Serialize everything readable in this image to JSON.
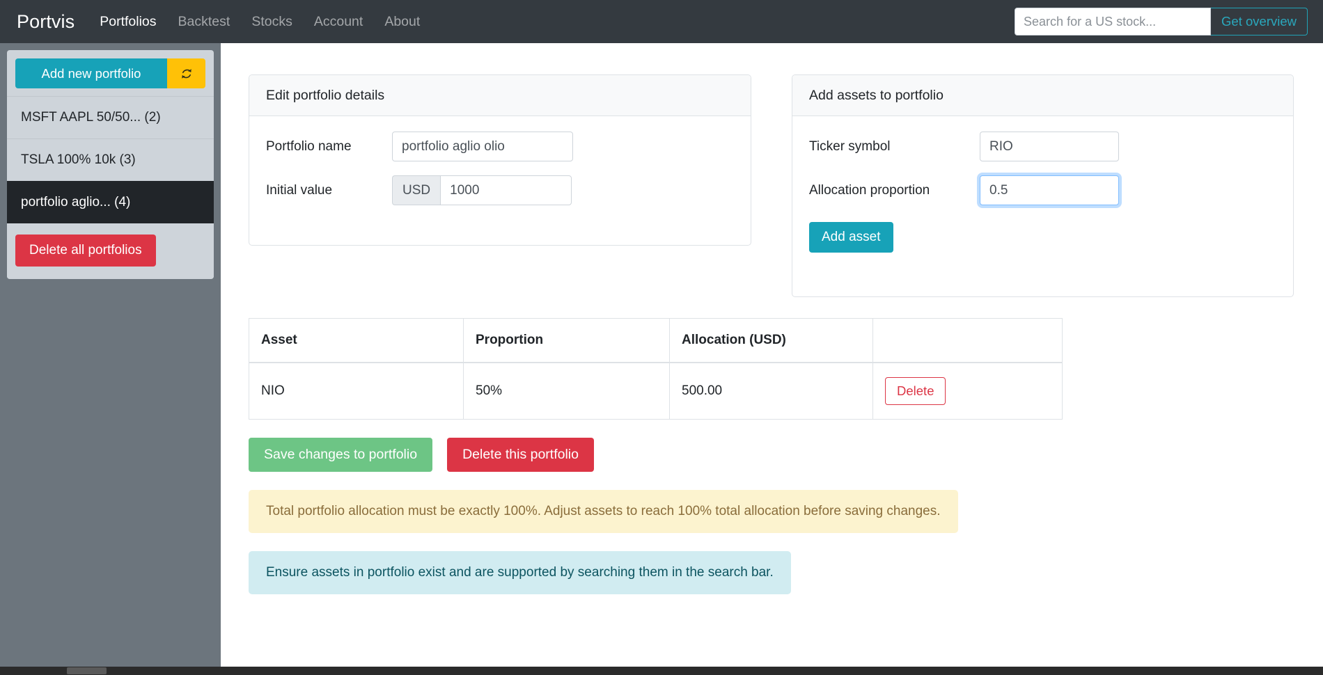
{
  "navbar": {
    "brand": "Portvis",
    "links": [
      {
        "label": "Portfolios",
        "active": true
      },
      {
        "label": "Backtest",
        "active": false
      },
      {
        "label": "Stocks",
        "active": false
      },
      {
        "label": "Account",
        "active": false
      },
      {
        "label": "About",
        "active": false
      }
    ],
    "search": {
      "placeholder": "Search for a US stock...",
      "value": ""
    },
    "overview_button": "Get overview"
  },
  "sidebar": {
    "add_portfolio_label": "Add new portfolio",
    "refresh_icon": "refresh-icon",
    "items": [
      {
        "label": "MSFT AAPL 50/50... (2)",
        "active": false
      },
      {
        "label": "TSLA 100% 10k (3)",
        "active": false
      },
      {
        "label": "portfolio aglio... (4)",
        "active": true
      }
    ],
    "delete_all_label": "Delete all portfolios"
  },
  "edit_card": {
    "header": "Edit portfolio details",
    "name_label": "Portfolio name",
    "name_value": "portfolio aglio olio",
    "initial_label": "Initial value",
    "currency_prefix": "USD",
    "initial_value": "1000"
  },
  "add_card": {
    "header": "Add assets to portfolio",
    "ticker_label": "Ticker symbol",
    "ticker_value": "RIO",
    "allocation_label": "Allocation proportion",
    "allocation_value": "0.5",
    "add_button": "Add asset"
  },
  "table": {
    "headers": [
      "Asset",
      "Proportion",
      "Allocation (USD)",
      ""
    ],
    "rows": [
      {
        "asset": "NIO",
        "proportion": "50%",
        "allocation": "500.00",
        "action": "Delete"
      }
    ]
  },
  "actions": {
    "save_label": "Save changes to portfolio",
    "delete_label": "Delete this portfolio"
  },
  "alerts": {
    "warning": "Total portfolio allocation must be exactly 100%. Adjust assets to reach 100% total allocation before saving changes.",
    "info": "Ensure assets in portfolio exist and are supported by searching them in the search bar."
  },
  "colors": {
    "navbar_bg": "#343a40",
    "accent_teal": "#17a2b8",
    "warning_yellow": "#ffc107",
    "danger_red": "#dc3545",
    "success_green": "#6dc585",
    "page_bg": "#6c757d"
  }
}
